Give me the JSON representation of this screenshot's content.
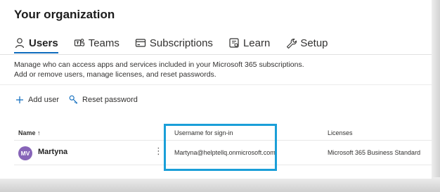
{
  "header": {
    "title": "Your organization"
  },
  "tabs": [
    {
      "label": "Users",
      "icon": "person-icon",
      "active": true
    },
    {
      "label": "Teams",
      "icon": "teams-icon",
      "active": false
    },
    {
      "label": "Subscriptions",
      "icon": "credit-card-icon",
      "active": false
    },
    {
      "label": "Learn",
      "icon": "learn-icon",
      "active": false
    },
    {
      "label": "Setup",
      "icon": "wrench-icon",
      "active": false
    }
  ],
  "description": "Manage who can access apps and services included in your Microsoft 365 subscriptions. Add or remove users, manage licenses, and reset passwords.",
  "actions": {
    "add_user": "Add user",
    "reset_password": "Reset password"
  },
  "table": {
    "columns": {
      "name": "Name ↑",
      "username": "Username for sign-in",
      "licenses": "Licenses"
    },
    "rows": [
      {
        "initials": "MV",
        "name": "Martyna",
        "more": "⋮",
        "username": "Martyna@helptellq.onmicrosoft.com",
        "licenses": "Microsoft 365 Business Standard"
      }
    ]
  },
  "colors": {
    "accent": "#0f6cbd",
    "avatar": "#8764b8",
    "highlight": "#1a9fd8"
  }
}
